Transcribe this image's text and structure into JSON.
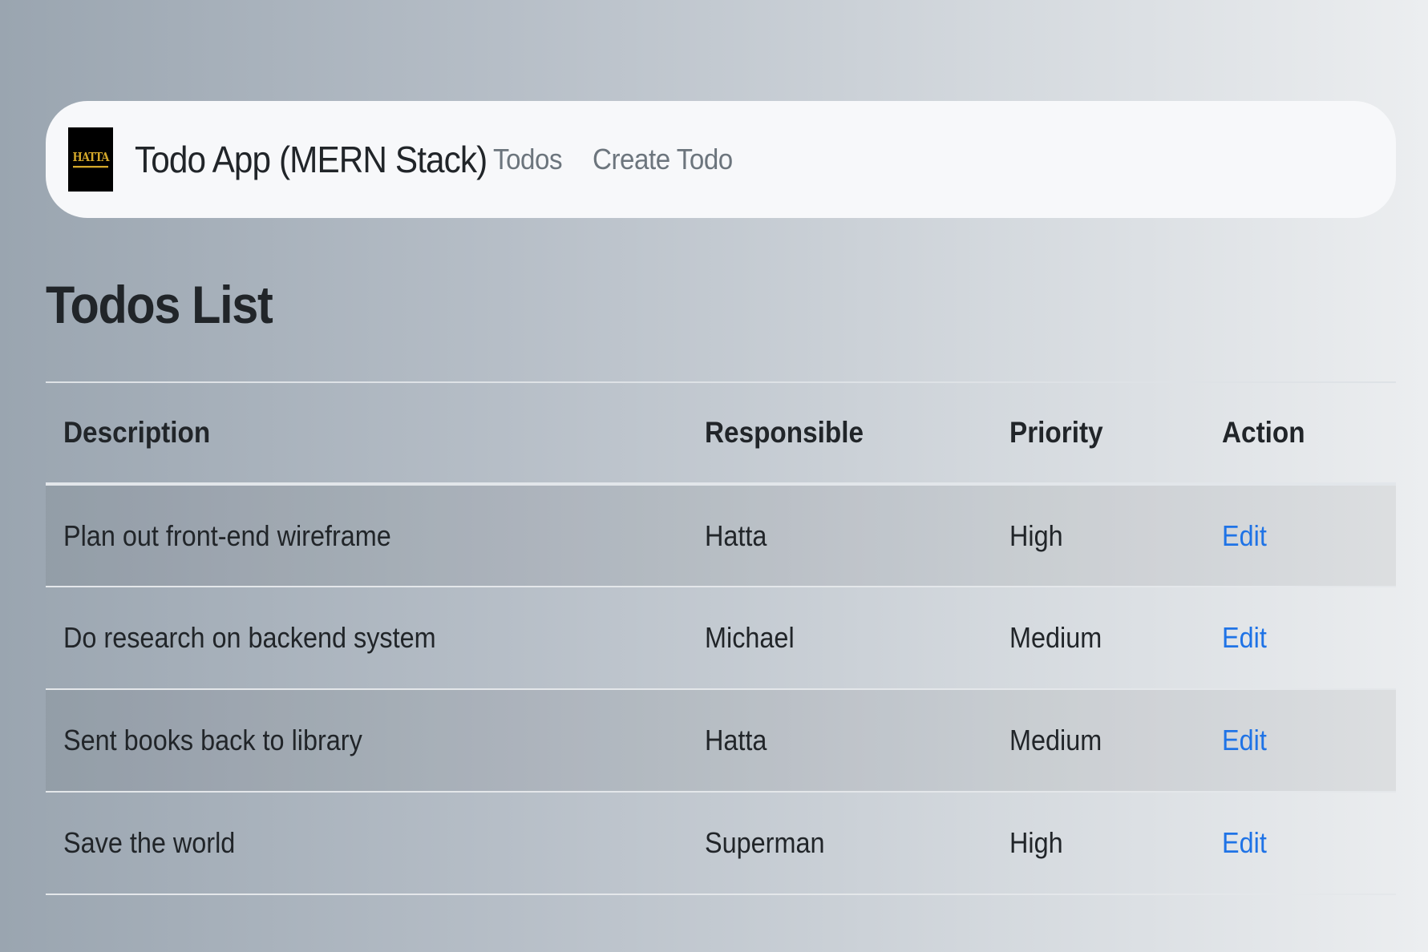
{
  "navbar": {
    "logo_text": "HATTA",
    "brand": "Todo App (MERN Stack)",
    "links": [
      {
        "label": "Todos"
      },
      {
        "label": "Create Todo"
      }
    ]
  },
  "page": {
    "title": "Todos List"
  },
  "table": {
    "headers": [
      "Description",
      "Responsible",
      "Priority",
      "Action"
    ],
    "rows": [
      {
        "description": "Plan out front-end wireframe",
        "responsible": "Hatta",
        "priority": "High",
        "action": "Edit"
      },
      {
        "description": "Do research on backend system",
        "responsible": "Michael",
        "priority": "Medium",
        "action": "Edit"
      },
      {
        "description": "Sent books back to library",
        "responsible": "Hatta",
        "priority": "Medium",
        "action": "Edit"
      },
      {
        "description": "Save the world",
        "responsible": "Superman",
        "priority": "High",
        "action": "Edit"
      }
    ]
  },
  "colors": {
    "link": "#1f73e6",
    "nav_link": "#6c757d",
    "text": "#212529",
    "logo_bg": "#000000",
    "logo_fg": "#d4a82a"
  }
}
